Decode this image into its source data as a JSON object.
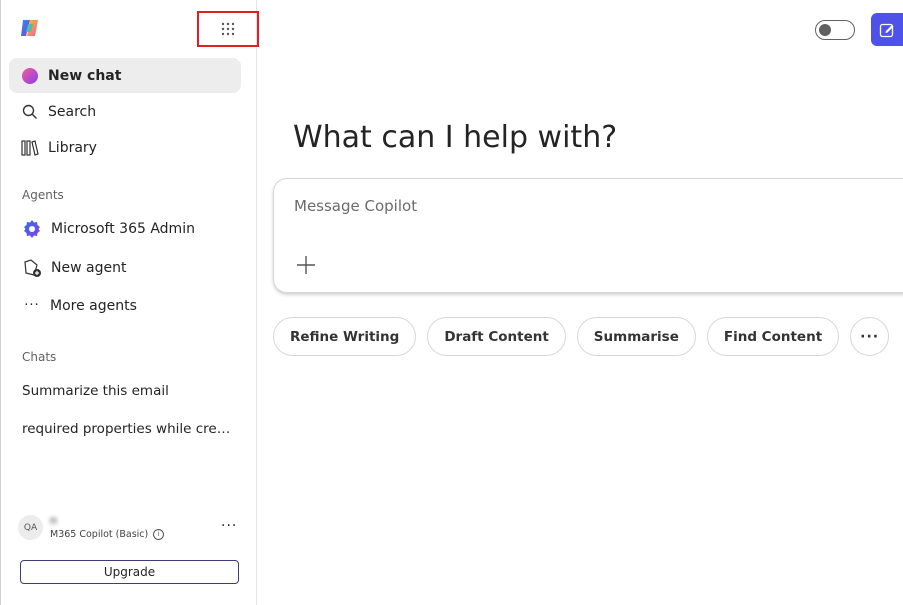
{
  "sidebar": {
    "nav": [
      {
        "label": "New chat",
        "icon": "copilot-chat-icon",
        "active": true
      },
      {
        "label": "Search",
        "icon": "search-icon"
      },
      {
        "label": "Library",
        "icon": "library-icon"
      }
    ],
    "agents_label": "Agents",
    "agents": [
      {
        "label": "Microsoft 365 Admin",
        "icon": "m365-admin-gear-icon"
      },
      {
        "label": "New agent",
        "icon": "new-agent-icon"
      },
      {
        "label": "More agents",
        "icon": "more-horizontal-icon"
      }
    ],
    "chats_label": "Chats",
    "chats": [
      {
        "label": "Summarize this email"
      },
      {
        "label": "required properties while creat..."
      }
    ],
    "user": {
      "initials": "QA",
      "name": "n",
      "plan": "M365 Copilot (Basic)",
      "more": "···"
    },
    "upgrade_label": "Upgrade"
  },
  "main": {
    "headline": "What can I help with?",
    "composer_placeholder": "Message Copilot",
    "chips": [
      "Refine Writing",
      "Draft Content",
      "Summarise",
      "Find Content"
    ],
    "chips_more": "···"
  },
  "colors": {
    "accent": "#4f52e8",
    "highlight_border": "#e02020",
    "active_bg": "#ededed"
  }
}
